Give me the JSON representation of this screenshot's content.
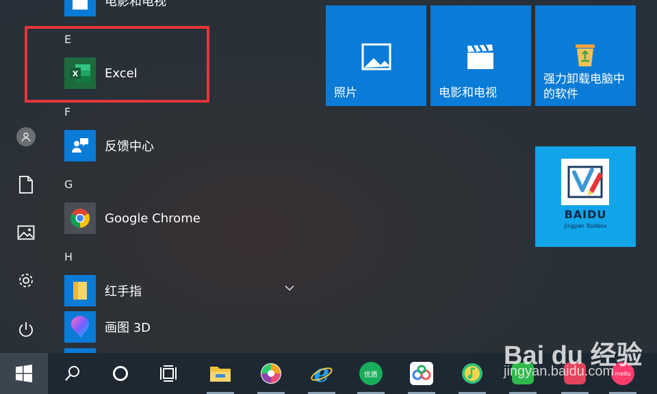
{
  "start_menu": {
    "rail": {
      "items": [
        {
          "icon": "user-icon"
        },
        {
          "icon": "document-icon"
        },
        {
          "icon": "pictures-icon"
        },
        {
          "icon": "settings-gear-icon"
        },
        {
          "icon": "power-icon"
        }
      ]
    },
    "app_list": {
      "partial_top_app": "电影和电视",
      "groups": [
        {
          "letter": "E",
          "apps": [
            {
              "label": "Excel",
              "icon": "excel-icon"
            }
          ]
        },
        {
          "letter": "F",
          "apps": [
            {
              "label": "反馈中心",
              "icon": "feedback-hub-icon"
            }
          ]
        },
        {
          "letter": "G",
          "apps": [
            {
              "label": "Google Chrome",
              "icon": "chrome-icon"
            }
          ]
        },
        {
          "letter": "H",
          "apps": [
            {
              "label": "红手指",
              "icon": "folder-icon",
              "expandable": true
            },
            {
              "label": "画图 3D",
              "icon": "paint3d-icon"
            }
          ]
        }
      ]
    },
    "tiles": [
      {
        "label": "照片",
        "icon": "photos-icon",
        "color": "#0a7bd6"
      },
      {
        "label": "电影和电视",
        "icon": "movies-tv-icon",
        "color": "#0a7bd6"
      },
      {
        "label_line1": "强力卸载电脑中",
        "label_line2": "的软件",
        "icon": "recycle-bin-icon",
        "color": "#0a7bd6"
      },
      {
        "label": "BAIDU",
        "sublabel": "jingyan Toolbox",
        "icon": "baidu-jingyan-toolbox-icon",
        "color": "#12a4e8"
      }
    ]
  },
  "taskbar": {
    "items": [
      {
        "icon": "windows-start-icon"
      },
      {
        "icon": "search-icon"
      },
      {
        "icon": "cortana-icon"
      },
      {
        "icon": "task-view-icon"
      },
      {
        "icon": "file-explorer-icon"
      },
      {
        "icon": "pinwheel-app-icon"
      },
      {
        "icon": "internet-explorer-icon"
      },
      {
        "icon": "youzhi-app-icon",
        "text": "优质"
      },
      {
        "icon": "baidu-netdisk-icon"
      },
      {
        "icon": "qq-music-icon"
      },
      {
        "icon": "green-app-icon"
      },
      {
        "icon": "red-app-icon"
      },
      {
        "icon": "meitu-icon",
        "text": "meitu"
      }
    ]
  },
  "watermark": {
    "brand": "Bai du 经验",
    "url": "jingyan.baidu.com"
  },
  "colors": {
    "accent_tile": "#0a7bd6",
    "highlight": "#e8353a",
    "taskbar": "#1e2832"
  }
}
